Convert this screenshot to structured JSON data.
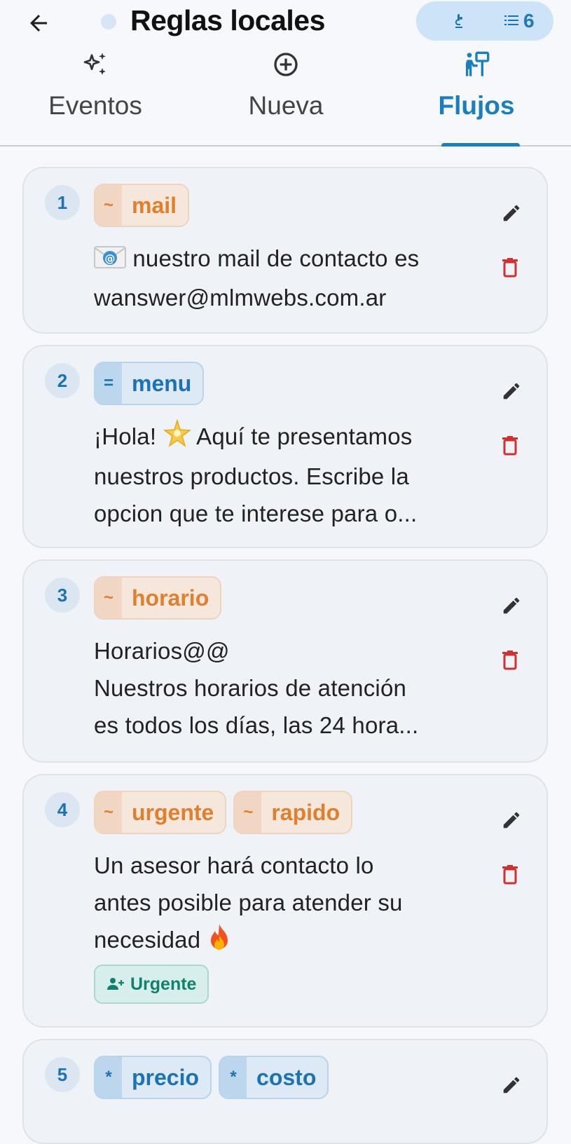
{
  "header": {
    "title": "Reglas locales",
    "flow_count": "6",
    "icons": [
      "arrow-left-icon",
      "status-dot",
      "flask-icon",
      "list-icon"
    ]
  },
  "tabs": [
    {
      "label": "Eventos",
      "icon": "sparkles-icon",
      "active": false
    },
    {
      "label": "Nueva",
      "icon": "plus-circle-icon",
      "active": false
    },
    {
      "label": "Flujos",
      "icon": "presenter-icon",
      "active": true
    }
  ],
  "cards": [
    {
      "number": "1",
      "keywords": [
        {
          "prefix": "~",
          "text": "mail",
          "color": "orange"
        }
      ],
      "lines": [
        " nuestro mail de contacto es",
        "wanswer@mlmwebs.com.ar"
      ]
    },
    {
      "number": "2",
      "keywords": [
        {
          "prefix": "=",
          "text": "menu",
          "color": "blue"
        }
      ],
      "lines": [
        "¡Hola! ",
        " Aquí te presentamos",
        "nuestros productos. Escribe la",
        "opcion que te interese para o..."
      ]
    },
    {
      "number": "3",
      "keywords": [
        {
          "prefix": "~",
          "text": "horario",
          "color": "orange"
        }
      ],
      "lines": [
        "Horarios@@",
        "Nuestros horarios de atención",
        "es todos los días, las 24 hora..."
      ]
    },
    {
      "number": "4",
      "keywords": [
        {
          "prefix": "~",
          "text": "urgente",
          "color": "orange"
        },
        {
          "prefix": "~",
          "text": "rapido",
          "color": "orange"
        }
      ],
      "lines": [
        "Un asesor hará contacto lo",
        "antes posible para atender su",
        "necesidad "
      ],
      "tag": "Urgente"
    },
    {
      "number": "5",
      "keywords": [
        {
          "prefix": "*",
          "text": "precio",
          "color": "blue"
        },
        {
          "prefix": "*",
          "text": "costo",
          "color": "blue"
        }
      ]
    }
  ],
  "colors": {
    "accent": "#1a7fbf",
    "orange": "#e07f2c",
    "delete": "#d0302f",
    "tag_green": "#12806d"
  }
}
